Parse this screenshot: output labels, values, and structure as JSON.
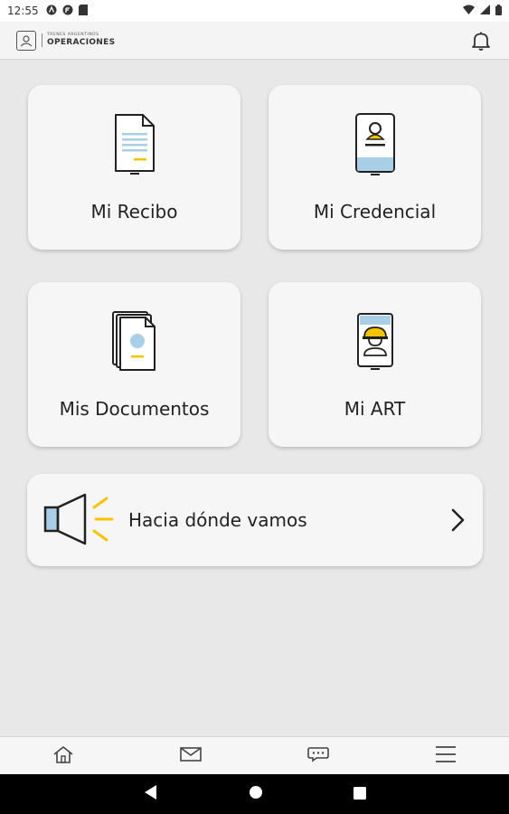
{
  "status_bar": {
    "time": "12:55"
  },
  "header": {
    "logo_top": "TRENES ARGENTINOS",
    "logo_bottom": "OPERACIONES",
    "notification_icon": "bell-icon"
  },
  "tiles": [
    {
      "label": "Mi Recibo",
      "icon": "receipt-document-icon"
    },
    {
      "label": "Mi Credencial",
      "icon": "credential-badge-icon"
    },
    {
      "label": "Mis Documentos",
      "icon": "documents-stack-icon"
    },
    {
      "label": "Mi ART",
      "icon": "worker-helmet-icon"
    }
  ],
  "banner": {
    "label": "Hacia dónde vamos",
    "icon": "megaphone-icon"
  },
  "bottom_nav": [
    {
      "icon": "home-icon"
    },
    {
      "icon": "mail-icon"
    },
    {
      "icon": "chat-icon"
    },
    {
      "icon": "menu-icon"
    }
  ],
  "colors": {
    "accent": "#f5c400",
    "accent_blue": "#a9cfe6",
    "background": "#e8e8e8",
    "card": "#f6f6f6"
  }
}
